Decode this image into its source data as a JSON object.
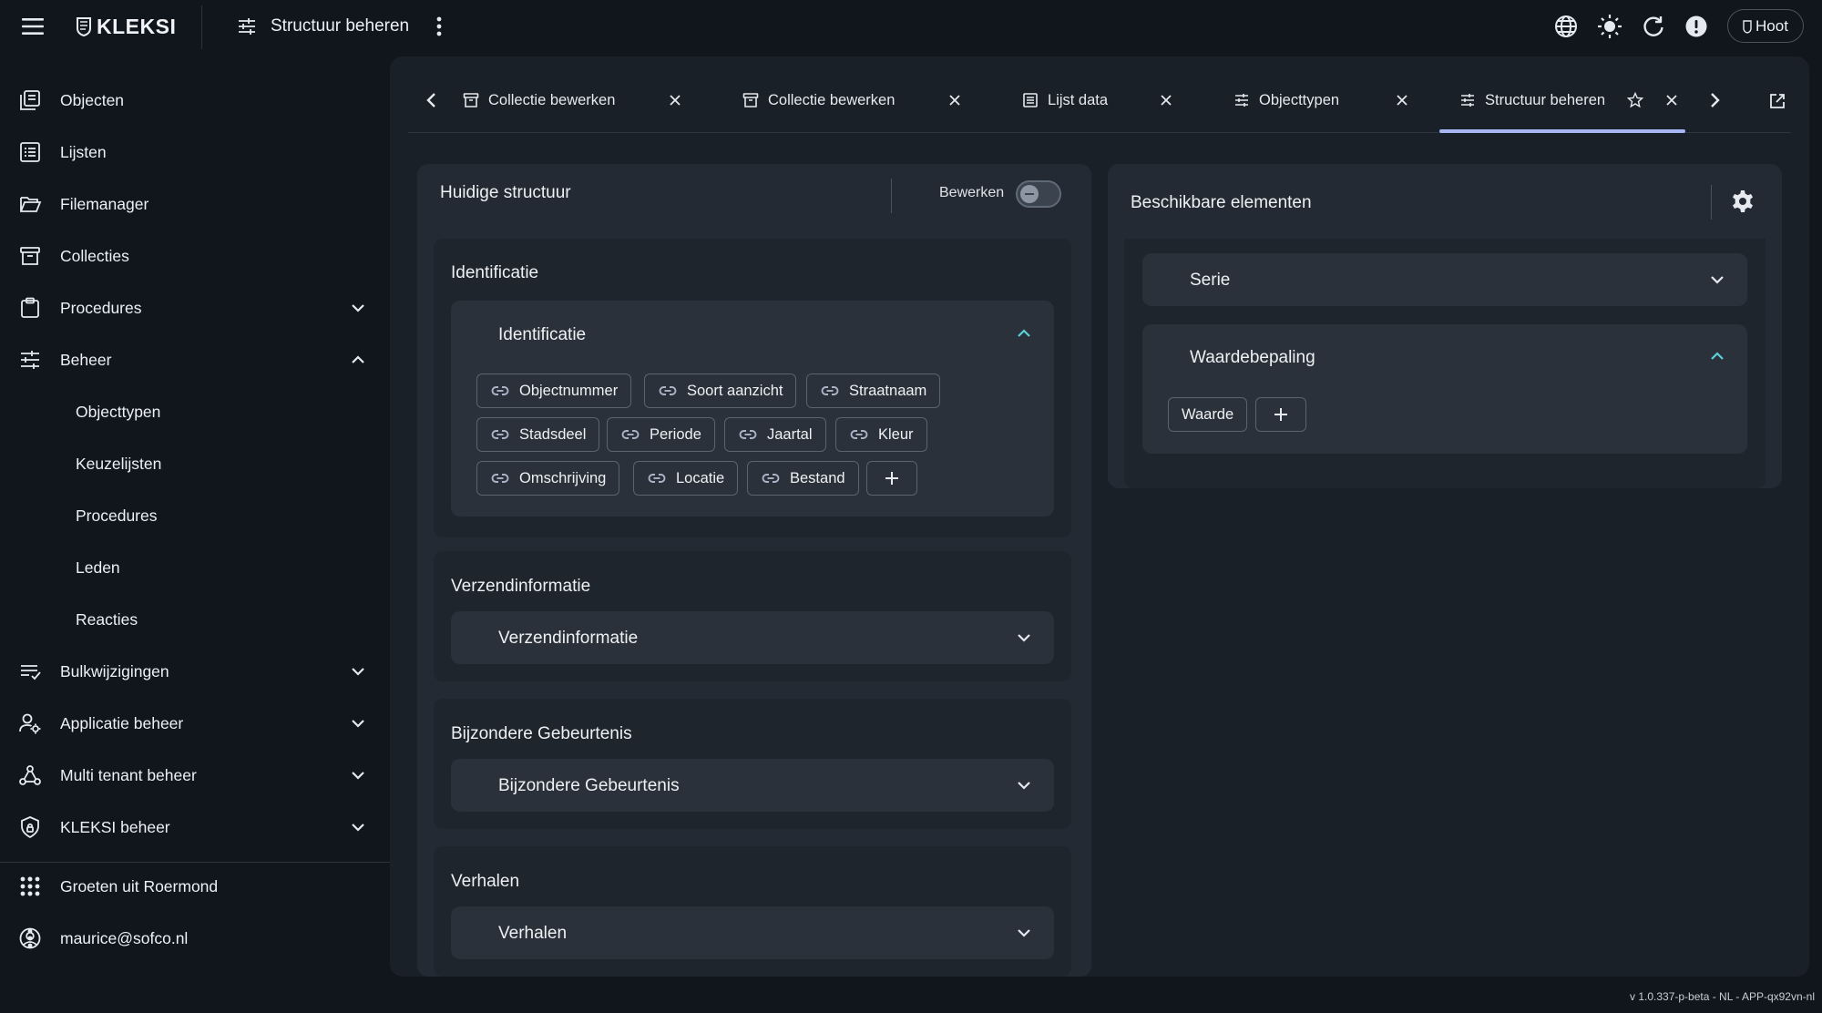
{
  "topbar": {
    "logo_text": "KLEKSI",
    "title": "Structuur beheren",
    "user_label": "Hoot"
  },
  "sidebar": {
    "items": [
      {
        "label": "Objecten"
      },
      {
        "label": "Lijsten"
      },
      {
        "label": "Filemanager"
      },
      {
        "label": "Collecties"
      },
      {
        "label": "Procedures"
      },
      {
        "label": "Beheer"
      },
      {
        "label": "Objecttypen"
      },
      {
        "label": "Keuzelijsten"
      },
      {
        "label": "Procedures"
      },
      {
        "label": "Leden"
      },
      {
        "label": "Reacties"
      },
      {
        "label": "Bulkwijzigingen"
      },
      {
        "label": "Applicatie beheer"
      },
      {
        "label": "Multi tenant beheer"
      },
      {
        "label": "KLEKSI beheer"
      }
    ],
    "tenant": "Groeten uit Roermond",
    "account": "maurice@sofco.nl"
  },
  "tabs": [
    {
      "label": "Collectie bewerken",
      "icon": "archive-icon"
    },
    {
      "label": "Collectie bewerken",
      "icon": "archive-icon"
    },
    {
      "label": "Lijst data",
      "icon": "list-icon"
    },
    {
      "label": "Objecttypen",
      "icon": "sliders-icon"
    },
    {
      "label": "Structuur beheren",
      "icon": "sliders-icon",
      "active": true
    }
  ],
  "left_panel": {
    "title": "Huidige structuur",
    "edit_label": "Bewerken",
    "edit_enabled": false,
    "sections": [
      {
        "title": "Identificatie",
        "accordion": "Identificatie",
        "expanded": true,
        "fields": [
          "Objectnummer",
          "Soort aanzicht",
          "Straatnaam",
          "Stadsdeel",
          "Periode",
          "Jaartal",
          "Kleur",
          "Omschrijving",
          "Locatie",
          "Bestand"
        ]
      },
      {
        "title": "Verzendinformatie",
        "accordion": "Verzendinformatie",
        "expanded": false
      },
      {
        "title": "Bijzondere Gebeurtenis",
        "accordion": "Bijzondere Gebeurtenis",
        "expanded": false
      },
      {
        "title": "Verhalen",
        "accordion": "Verhalen",
        "expanded": false
      }
    ]
  },
  "right_panel": {
    "title": "Beschikbare elementen",
    "groups": [
      {
        "label": "Serie",
        "expanded": false
      },
      {
        "label": "Waardebepaling",
        "expanded": true,
        "fields": [
          "Waarde"
        ]
      }
    ]
  },
  "version": "v 1.0.337-p-beta - NL - APP-qx92vn-nl",
  "colors": {
    "background": "#11161c",
    "panel": "#232a33",
    "accent": "#a9b6f5",
    "teal": "#5ad1d8"
  }
}
